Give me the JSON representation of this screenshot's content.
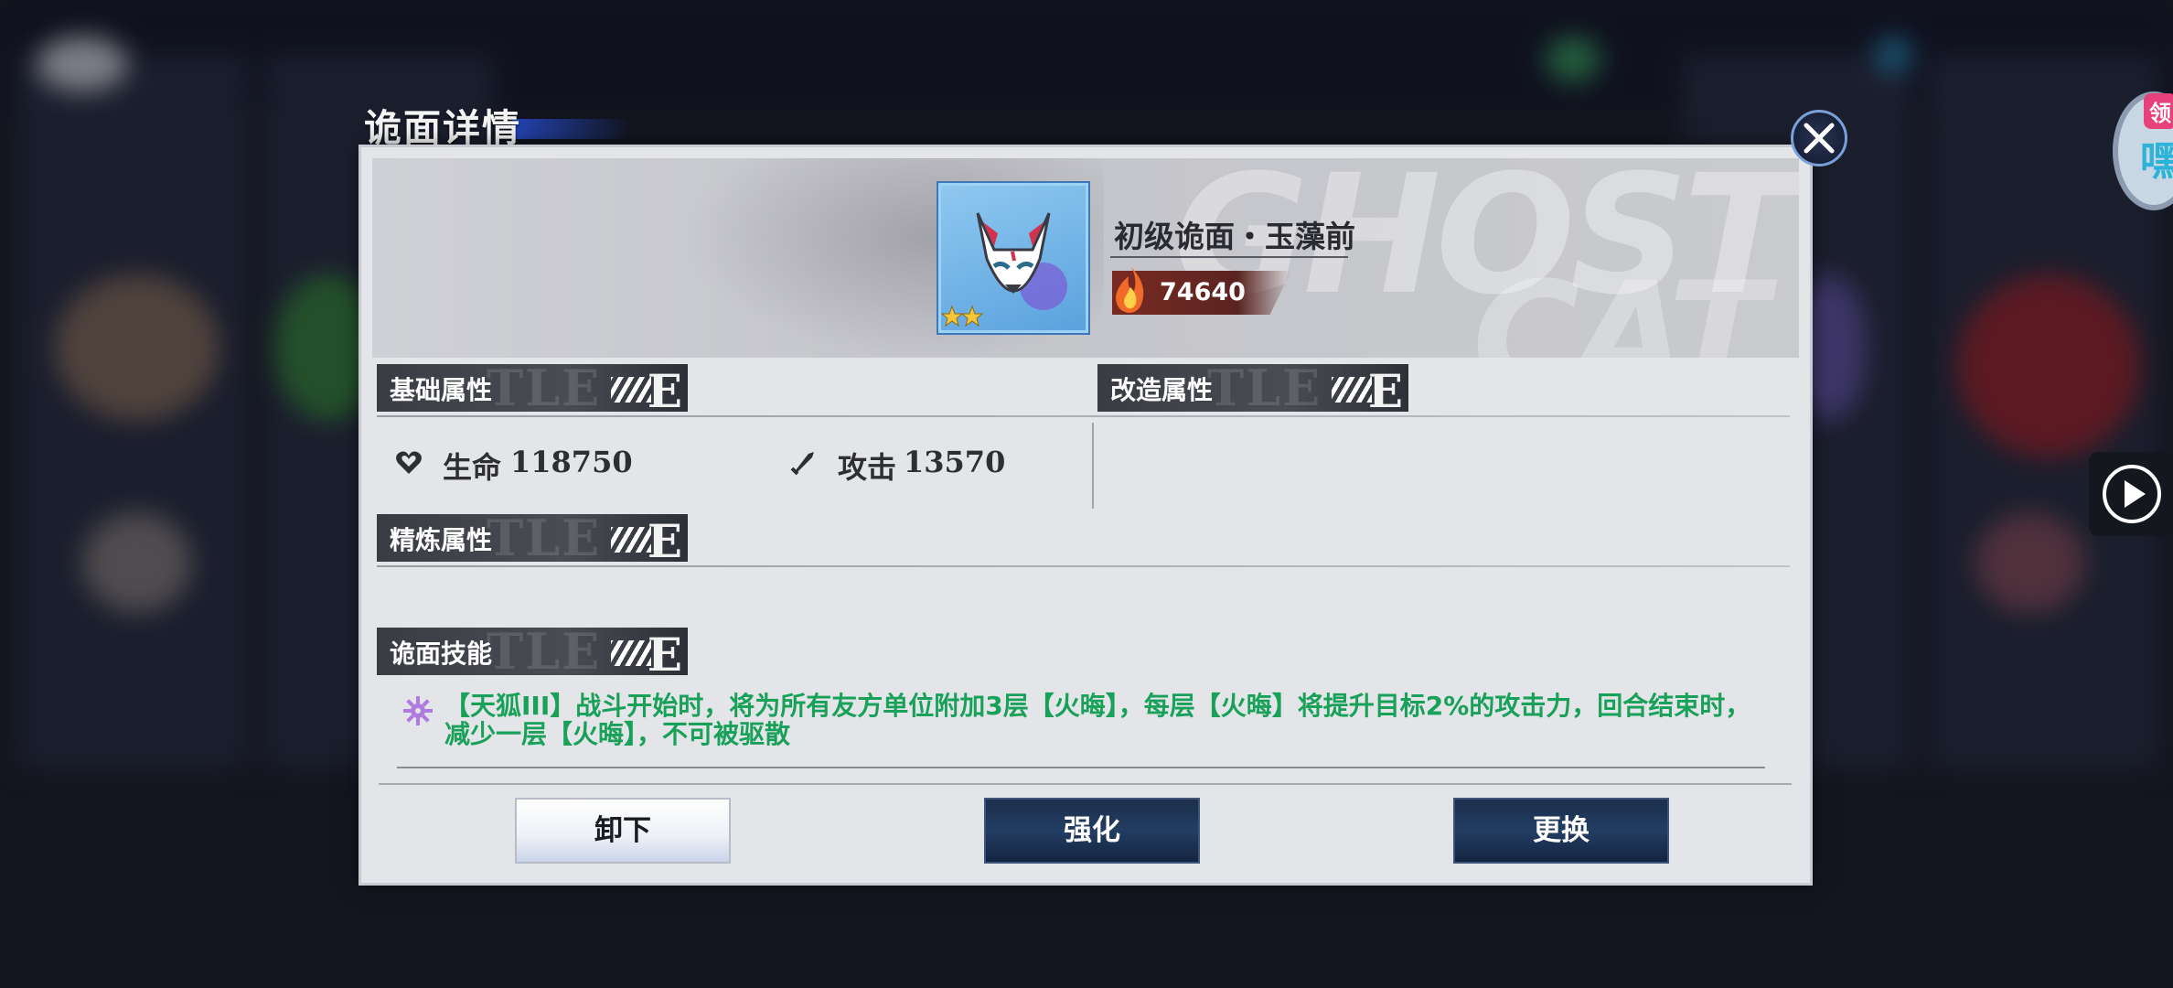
{
  "modal": {
    "title": "诡面详情",
    "item": {
      "name": "初级诡面・玉藻前",
      "power": "74640",
      "stars": 2
    },
    "sections": {
      "base": "基础属性",
      "modify": "改造属性",
      "refine": "精炼属性",
      "skill": "诡面技能"
    },
    "stats": {
      "hp_label": "生命",
      "hp_value": "118750",
      "atk_label": "攻击",
      "atk_value": "13570"
    },
    "skill_text": "【天狐III】战斗开始时，将为所有友方单位附加3层【火晦】，每层【火晦】将提升目标2%的攻击力，回合结束时，减少一层【火晦】，不可被驱散",
    "buttons": {
      "unequip": "卸下",
      "enhance": "强化",
      "replace": "更换"
    }
  },
  "side": {
    "badge": "领",
    "avatar_char": "嘿"
  },
  "colors": {
    "skill_text": "#19a15a",
    "panel_bg": "#e4e5e9",
    "dark_button": "#233d63"
  }
}
